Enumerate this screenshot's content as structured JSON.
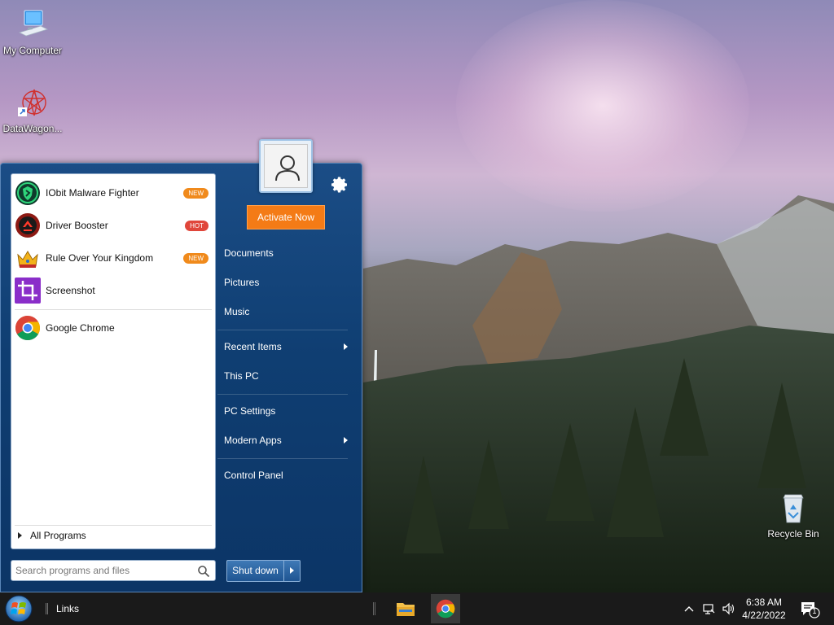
{
  "desktop": {
    "icons": [
      {
        "label": "My Computer"
      },
      {
        "label": "DataWagon..."
      },
      {
        "label": "Recycle Bin"
      }
    ]
  },
  "start_menu": {
    "programs": [
      {
        "label": "IObit Malware Fighter",
        "badge": "NEW",
        "badge_color": "#f08a1c"
      },
      {
        "label": "Driver Booster",
        "badge": "HOT",
        "badge_color": "#e0463a"
      },
      {
        "label": "Rule Over Your Kingdom",
        "badge": "NEW",
        "badge_color": "#f08a1c"
      },
      {
        "label": "Screenshot",
        "badge": ""
      },
      {
        "label": "Google Chrome",
        "badge": ""
      }
    ],
    "all_programs": "All Programs",
    "search_placeholder": "Search programs and files",
    "activate_label": "Activate Now",
    "right_items": [
      {
        "label": "Documents"
      },
      {
        "label": "Pictures"
      },
      {
        "label": "Music"
      },
      {
        "label": "Recent Items"
      },
      {
        "label": "This PC"
      },
      {
        "label": "PC Settings"
      },
      {
        "label": "Modern Apps"
      },
      {
        "label": "Control Panel"
      }
    ],
    "shutdown_label": "Shut down"
  },
  "taskbar": {
    "links_label": "Links",
    "time": "6:38 AM",
    "date": "4/22/2022",
    "notification_count": "1"
  },
  "colors": {
    "accent": "#f47b16",
    "menu_blue": "#0f3e72"
  }
}
